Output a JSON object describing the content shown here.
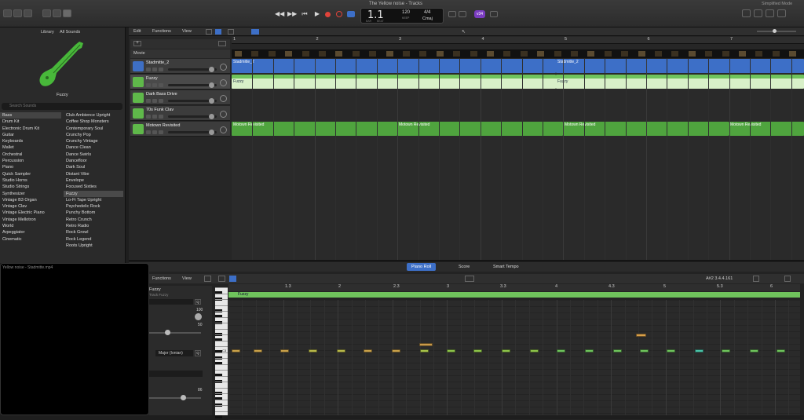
{
  "window": {
    "title": "The Yellow noise - Tracks",
    "simplified_mode": "Simplified Mode"
  },
  "lcd": {
    "bar": "1.1",
    "tempo": "120",
    "tempo_label": "KEEP",
    "signature": "4/4",
    "key": "Cmaj",
    "bar_label": "BAR",
    "beat_label": "BEAT"
  },
  "badge": "v34",
  "library": {
    "title": "Library",
    "filter": "All Sounds",
    "preview_name": "Fuzzy",
    "search_placeholder": "Search Sounds",
    "categories": [
      "Bass",
      "Drum Kit",
      "Electronic Drum Kit",
      "Guitar",
      "Keyboards",
      "Mallet",
      "Orchestral",
      "Percussion",
      "Piano",
      "Quick Sampler",
      "Studio Horns",
      "Studio Strings",
      "Synthesizer",
      "Vintage B3 Organ",
      "Vintage Clav",
      "Vintage Electric Piano",
      "Vintage Mellotron",
      "World",
      "Arpeggiator",
      "Cinematic"
    ],
    "patches": [
      "Club Ambience Upright",
      "Coffee Shop Monsters",
      "Contemporary Soul",
      "Crunchy Pop",
      "Crunchy Vintage",
      "Dance Clean",
      "Dance Swirls",
      "Dancefloor",
      "Dark Soul",
      "Distant Vibe",
      "Envelope",
      "Focused Sixties",
      "Fuzzy",
      "Lo-Fi Tape Upright",
      "Psychedelic Rock",
      "Punchy Bottom",
      "Retro Crunch",
      "Retro Radio",
      "Rock Growl",
      "Rock Legend",
      "Roots Upright"
    ]
  },
  "tracks_toolbar": {
    "edit": "Edit",
    "functions": "Functions",
    "view": "View"
  },
  "movie_label": "Movie",
  "tracks": [
    {
      "name": "Stadmitte_2",
      "color": "#3e6fc4"
    },
    {
      "name": "Fuzzy",
      "color": "#5fb84a"
    },
    {
      "name": "Dark Bass Drive",
      "color": "#5fb84a"
    },
    {
      "name": "70s Funk Clav",
      "color": "#5fb84a"
    },
    {
      "name": "Motown Revisited",
      "color": "#5fb84a"
    }
  ],
  "ruler_bars": [
    "1",
    "2",
    "3",
    "4",
    "5",
    "6",
    "7"
  ],
  "regions": {
    "audio": [
      "Stadmitte_2",
      "Stadmitte_2"
    ],
    "fuzzy": [
      "Fuzzy",
      "Fuzzy"
    ],
    "motown": [
      "Motown Revisited",
      "Motown Revisited",
      "Motown Revisited",
      "Motown Revisited"
    ]
  },
  "editor": {
    "tabs": [
      "Piano Roll",
      "Score",
      "Smart Tempo"
    ],
    "functions": "Functions",
    "view": "View",
    "position": "A#2  3.4.4.161",
    "region_name": "Fuzzy",
    "region_sub": "Track Fuzzy",
    "velocity": "100",
    "val50": "50",
    "scale_label": "Major (Ionian)",
    "val86": "86",
    "ruler": [
      "1.3",
      "2",
      "2.3",
      "3",
      "3.3",
      "4",
      "4.3",
      "5",
      "5.3",
      "6"
    ],
    "c_label": "C3"
  },
  "video": {
    "title": "Yellow noise - Stadmitte.mp4"
  }
}
